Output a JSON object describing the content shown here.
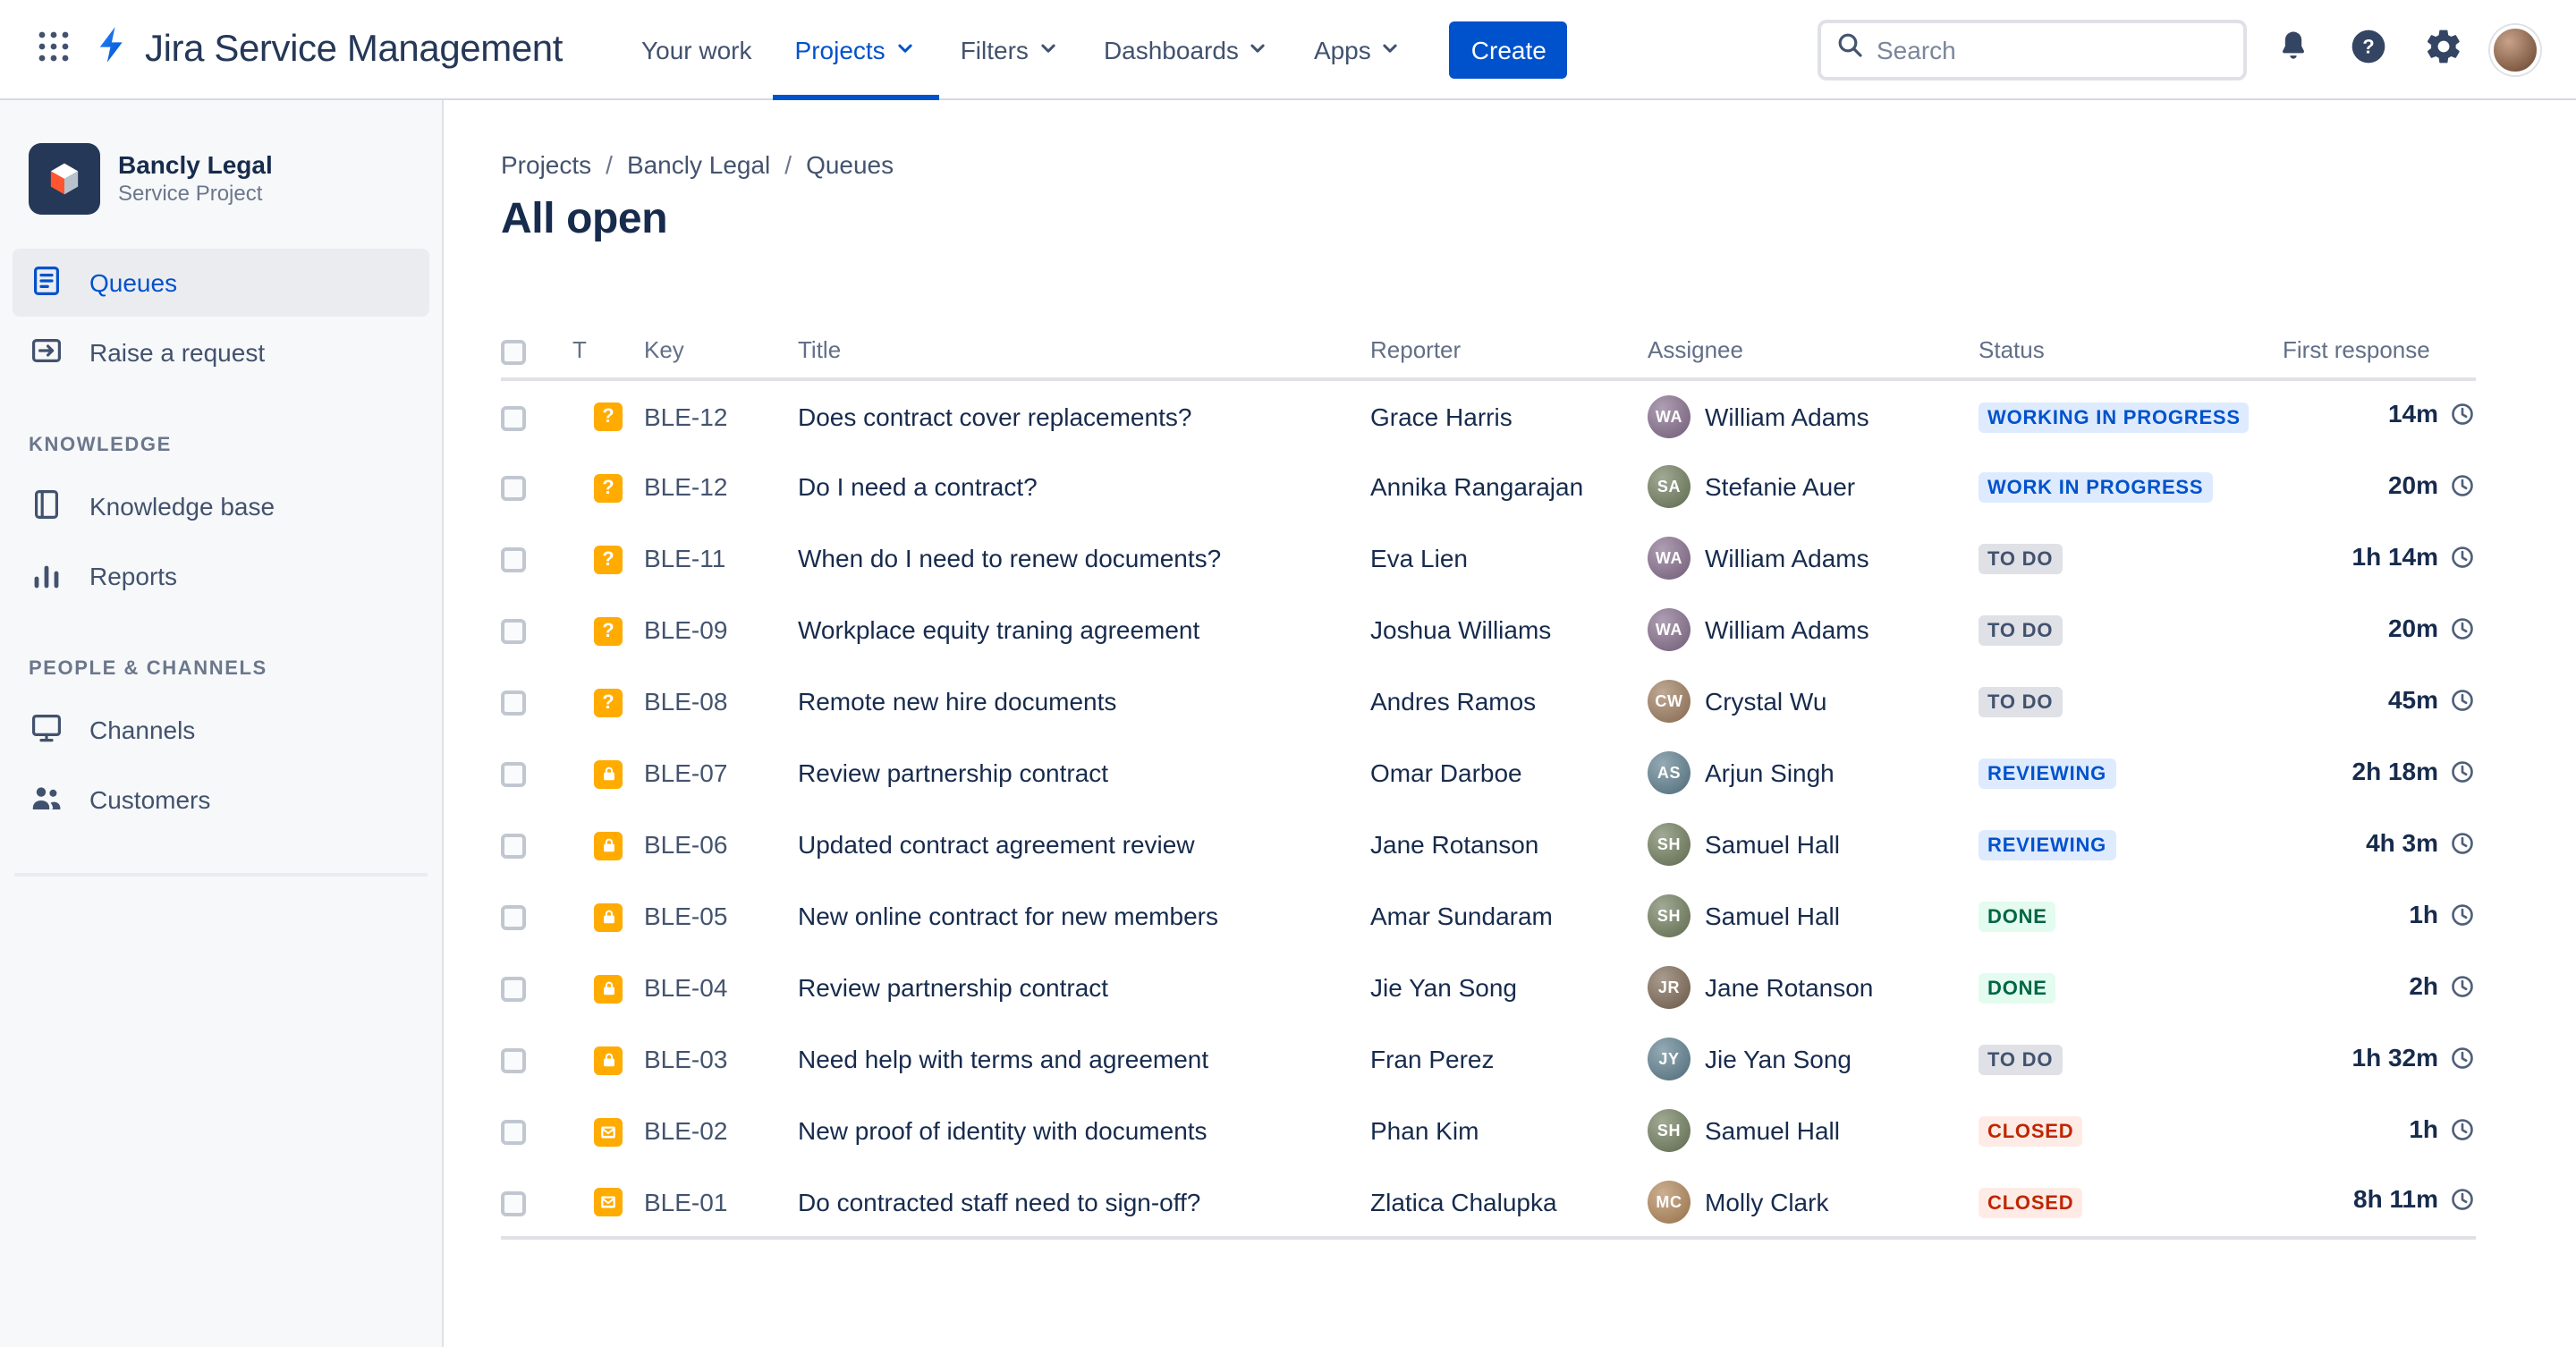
{
  "topbar": {
    "product_name": "Jira Service Management",
    "nav": [
      {
        "label": "Your work"
      },
      {
        "label": "Projects"
      },
      {
        "label": "Filters"
      },
      {
        "label": "Dashboards"
      },
      {
        "label": "Apps"
      }
    ],
    "create_label": "Create",
    "search": {
      "placeholder": "Search"
    }
  },
  "sidebar": {
    "project_name": "Bancly Legal",
    "project_type": "Service Project",
    "items": [
      {
        "label": "Queues"
      },
      {
        "label": "Raise a request"
      }
    ],
    "sections": [
      {
        "heading": "KNOWLEDGE",
        "items": [
          {
            "label": "Knowledge base"
          },
          {
            "label": "Reports"
          }
        ]
      },
      {
        "heading": "PEOPLE & CHANNELS",
        "items": [
          {
            "label": "Channels"
          },
          {
            "label": "Customers"
          }
        ]
      }
    ]
  },
  "main": {
    "breadcrumbs": [
      {
        "label": "Projects"
      },
      {
        "label": "Bancly Legal"
      },
      {
        "label": "Queues"
      }
    ],
    "breadcrumb_separator": "/",
    "title": "All open",
    "table": {
      "columns": {
        "type": "T",
        "key": "Key",
        "title": "Title",
        "reporter": "Reporter",
        "assignee": "Assignee",
        "status": "Status",
        "first_response": "First response"
      },
      "rows": [
        {
          "type": "question",
          "key": "BLE-12",
          "title": "Does contract cover replacements?",
          "reporter": "Grace Harris",
          "assignee": "William Adams",
          "status": "WORKING IN PROGRESS",
          "status_color": "blue",
          "first_response": "14m"
        },
        {
          "type": "question",
          "key": "BLE-12",
          "title": "Do I need a contract?",
          "reporter": "Annika Rangarajan",
          "assignee": "Stefanie Auer",
          "status": "WORK IN PROGRESS",
          "status_color": "blue",
          "first_response": "20m"
        },
        {
          "type": "question",
          "key": "BLE-11",
          "title": "When do I need to renew documents?",
          "reporter": "Eva Lien",
          "assignee": "William Adams",
          "status": "TO DO",
          "status_color": "gray",
          "first_response": "1h 14m"
        },
        {
          "type": "question",
          "key": "BLE-09",
          "title": "Workplace equity traning agreement",
          "reporter": "Joshua Williams",
          "assignee": "William Adams",
          "status": "TO DO",
          "status_color": "gray",
          "first_response": "20m"
        },
        {
          "type": "question",
          "key": "BLE-08",
          "title": "Remote new hire documents",
          "reporter": "Andres Ramos",
          "assignee": "Crystal Wu",
          "status": "TO DO",
          "status_color": "gray",
          "first_response": "45m"
        },
        {
          "type": "lock",
          "key": "BLE-07",
          "title": "Review partnership contract",
          "reporter": "Omar Darboe",
          "assignee": "Arjun Singh",
          "status": "REVIEWING",
          "status_color": "blue",
          "first_response": "2h 18m"
        },
        {
          "type": "lock",
          "key": "BLE-06",
          "title": "Updated contract agreement review",
          "reporter": "Jane Rotanson",
          "assignee": "Samuel Hall",
          "status": "REVIEWING",
          "status_color": "blue",
          "first_response": "4h 3m"
        },
        {
          "type": "lock",
          "key": "BLE-05",
          "title": "New online contract for new members",
          "reporter": "Amar Sundaram",
          "assignee": "Samuel Hall",
          "status": "DONE",
          "status_color": "green",
          "first_response": "1h"
        },
        {
          "type": "lock",
          "key": "BLE-04",
          "title": "Review partnership contract",
          "reporter": "Jie Yan Song",
          "assignee": "Jane Rotanson",
          "status": "DONE",
          "status_color": "green",
          "first_response": "2h"
        },
        {
          "type": "lock",
          "key": "BLE-03",
          "title": "Need help with terms and agreement",
          "reporter": "Fran Perez",
          "assignee": "Jie Yan Song",
          "status": "TO DO",
          "status_color": "gray",
          "first_response": "1h 32m"
        },
        {
          "type": "email",
          "key": "BLE-02",
          "title": "New proof of identity with documents",
          "reporter": "Phan Kim",
          "assignee": "Samuel Hall",
          "status": "CLOSED",
          "status_color": "red",
          "first_response": "1h"
        },
        {
          "type": "email",
          "key": "BLE-01",
          "title": "Do contracted staff need to sign-off?",
          "reporter": "Zlatica Chalupka",
          "assignee": "Molly Clark",
          "status": "CLOSED",
          "status_color": "red",
          "first_response": "8h 11m"
        }
      ]
    }
  },
  "icons": {
    "question_type_glyph": "?"
  },
  "colors": {
    "accent": "#0052CC",
    "type_icon_bg": "#FFAB00",
    "status": {
      "blue": {
        "bg": "#DEEBFF",
        "fg": "#0052CC"
      },
      "gray": {
        "bg": "#DFE1E6",
        "fg": "#42526E"
      },
      "green": {
        "bg": "#E3FCEF",
        "fg": "#006644"
      },
      "red": {
        "bg": "#FFEBE6",
        "fg": "#BF2600"
      }
    }
  }
}
